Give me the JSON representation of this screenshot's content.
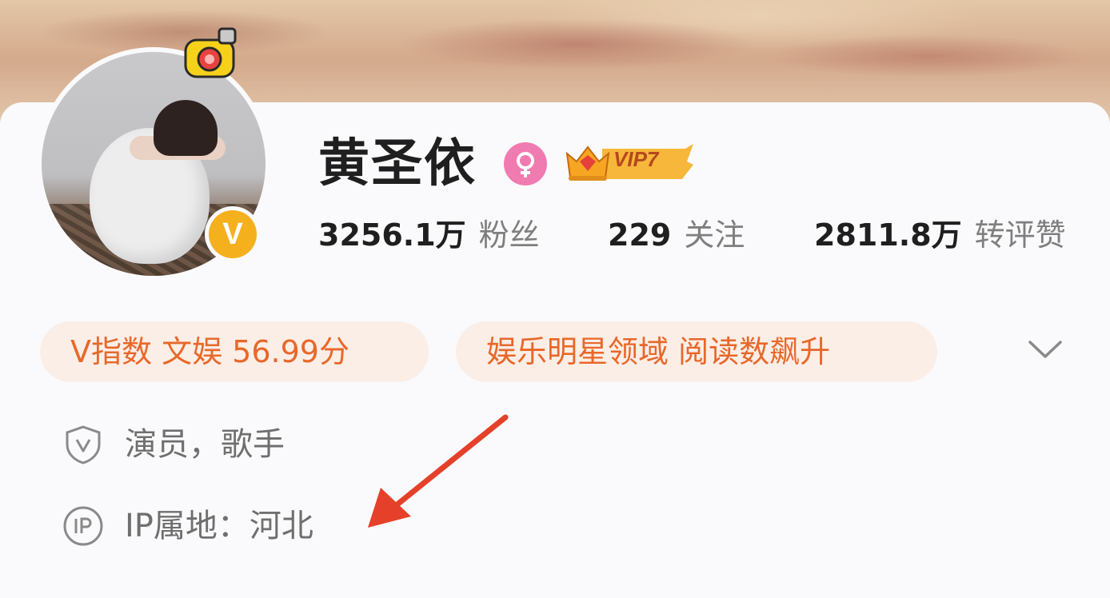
{
  "profile": {
    "name": "黄圣依",
    "vip_label": "VIP7"
  },
  "stats": [
    {
      "value": "3256.1万",
      "label": "粉丝"
    },
    {
      "value": "229",
      "label": "关注"
    },
    {
      "value": "2811.8万",
      "label": "转评赞"
    }
  ],
  "tags": [
    {
      "label": "V指数 文娱 56.99分"
    },
    {
      "label": "娱乐明星领域 阅读数飙升"
    }
  ],
  "info": {
    "occupation": "演员，歌手",
    "ip_location": "IP属地：河北"
  },
  "colors": {
    "accent": "#e8682a",
    "tag_bg": "#fbeee7",
    "v_badge": "#f5b01d",
    "annotation_arrow": "#e5412a",
    "gender_badge": "#f07bb0"
  },
  "icons": {
    "verified": "v-badge-icon",
    "gender": "female-icon",
    "vip": "crown-icon",
    "expand": "chevron-down-icon",
    "occupation": "shield-v-icon",
    "ip": "ip-circle-icon"
  }
}
